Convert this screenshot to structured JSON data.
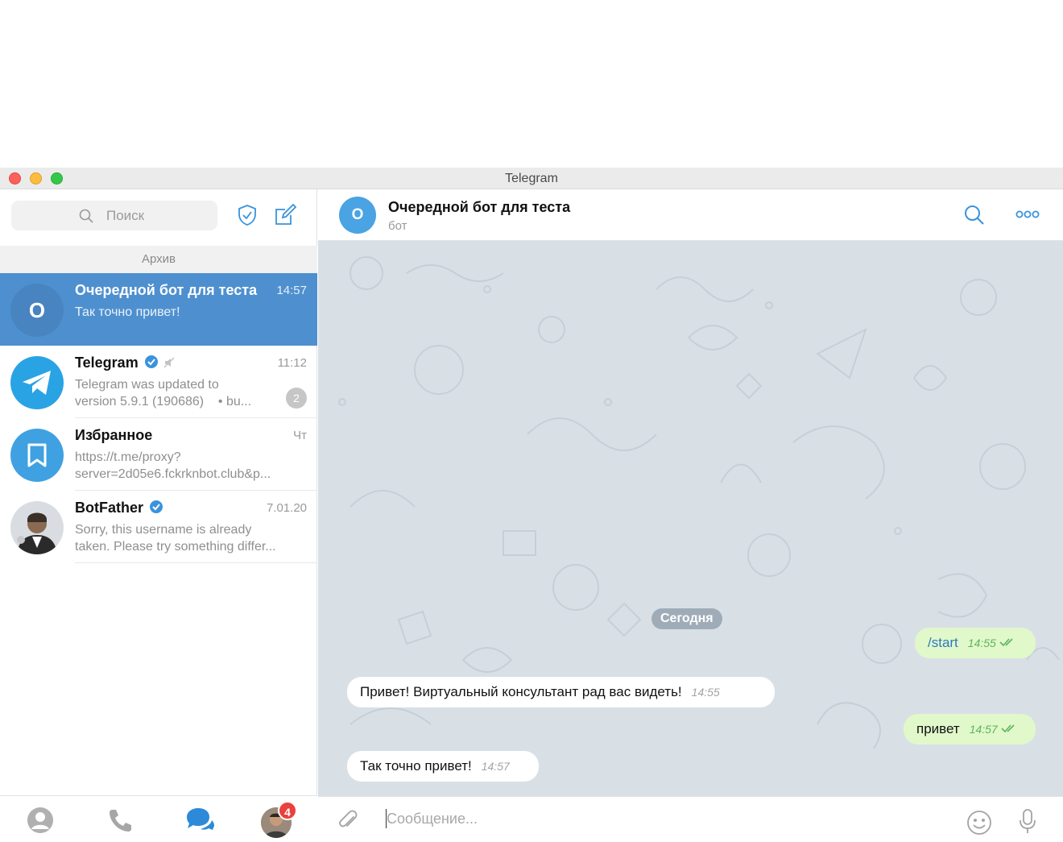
{
  "window": {
    "title": "Telegram"
  },
  "sidebar": {
    "search_placeholder": "Поиск",
    "archive_label": "Архив",
    "chats": [
      {
        "name": "Очередной бот для теста",
        "time": "14:57",
        "preview": "Так точно привет!",
        "avatar_letter": "О",
        "active": true
      },
      {
        "name": "Telegram",
        "time": "11:12",
        "preview_line1": "Telegram was updated to",
        "preview_line2": "version 5.9.1 (190686)",
        "preview_more": "• bu...",
        "unread": "2",
        "verified": true,
        "muted": true
      },
      {
        "name": "Избранное",
        "time": "Чт",
        "preview_line1": "https://t.me/proxy?",
        "preview_line2": "server=2d05e6.fckrknbot.club&p..."
      },
      {
        "name": "BotFather",
        "time": "7.01.20",
        "preview_line1": "Sorry, this username is already",
        "preview_line2": "taken. Please try something differ...",
        "verified": true
      }
    ],
    "footer": {
      "avatar_badge": "4"
    }
  },
  "chat": {
    "avatar_letter": "О",
    "title": "Очередной бот для теста",
    "subtitle": "бот",
    "date_separator": "Сегодня",
    "messages": [
      {
        "dir": "out",
        "text": "/start",
        "time": "14:55"
      },
      {
        "dir": "in",
        "text": "Привет! Виртуальный консультант рад вас видеть!",
        "time": "14:55"
      },
      {
        "dir": "out",
        "text": "привет",
        "time": "14:57"
      },
      {
        "dir": "in",
        "text": "Так точно привет!",
        "time": "14:57"
      }
    ],
    "composer_placeholder": "Сообщение..."
  },
  "colors": {
    "accent": "#4e90cf",
    "chat_bg": "#d8e0e6",
    "outgoing": "#e1f8cb",
    "badge": "#e8413e"
  }
}
